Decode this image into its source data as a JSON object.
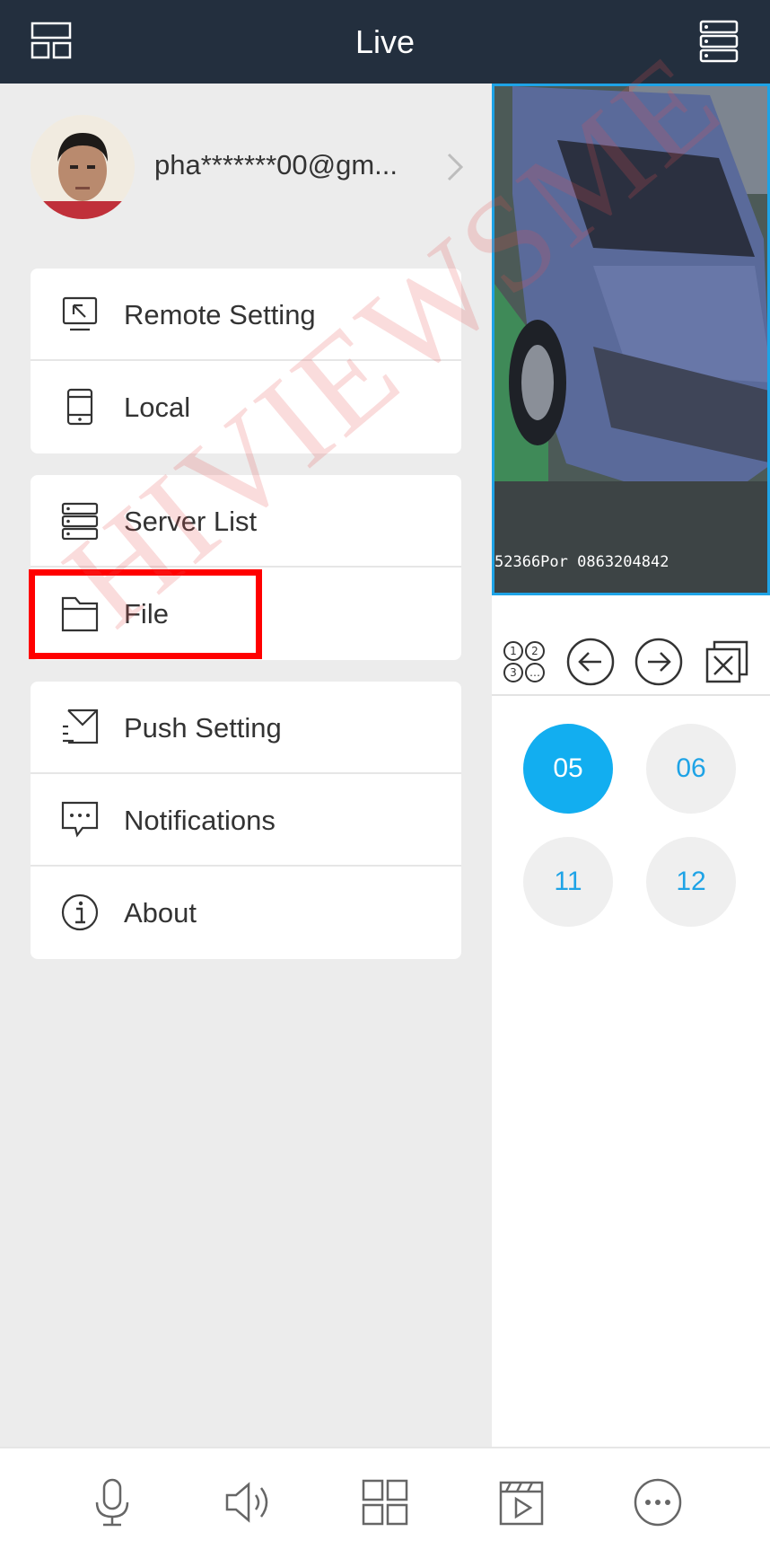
{
  "header": {
    "title": "Live",
    "left_icon": "layout-icon",
    "right_icon": "server-list-icon"
  },
  "video": {
    "osd": "52366Por 0863204842"
  },
  "controls": [
    "split-view-icon",
    "previous-icon",
    "next-icon",
    "close-all-icon"
  ],
  "channels": [
    {
      "label": "05",
      "active": true
    },
    {
      "label": "06",
      "active": false
    },
    {
      "label": "11",
      "active": false
    },
    {
      "label": "12",
      "active": false
    }
  ],
  "profile": {
    "email": "pha*******00@gm..."
  },
  "menu": {
    "group1": [
      {
        "label": "Remote Setting",
        "icon": "remote-setting-icon"
      },
      {
        "label": "Local",
        "icon": "local-device-icon"
      }
    ],
    "group2": [
      {
        "label": "Server List",
        "icon": "server-list-icon"
      },
      {
        "label": "File",
        "icon": "folder-icon"
      }
    ],
    "group3": [
      {
        "label": "Push Setting",
        "icon": "push-setting-icon"
      },
      {
        "label": "Notifications",
        "icon": "notifications-icon"
      },
      {
        "label": "About",
        "icon": "info-icon"
      }
    ]
  },
  "watermark": "HIVIEWSME",
  "bottom_nav": [
    "microphone-icon",
    "speaker-icon",
    "grid-icon",
    "playback-icon",
    "more-icon"
  ],
  "colors": {
    "header_bg": "#232f3e",
    "accent": "#12aef0",
    "highlight": "#ff0000"
  }
}
